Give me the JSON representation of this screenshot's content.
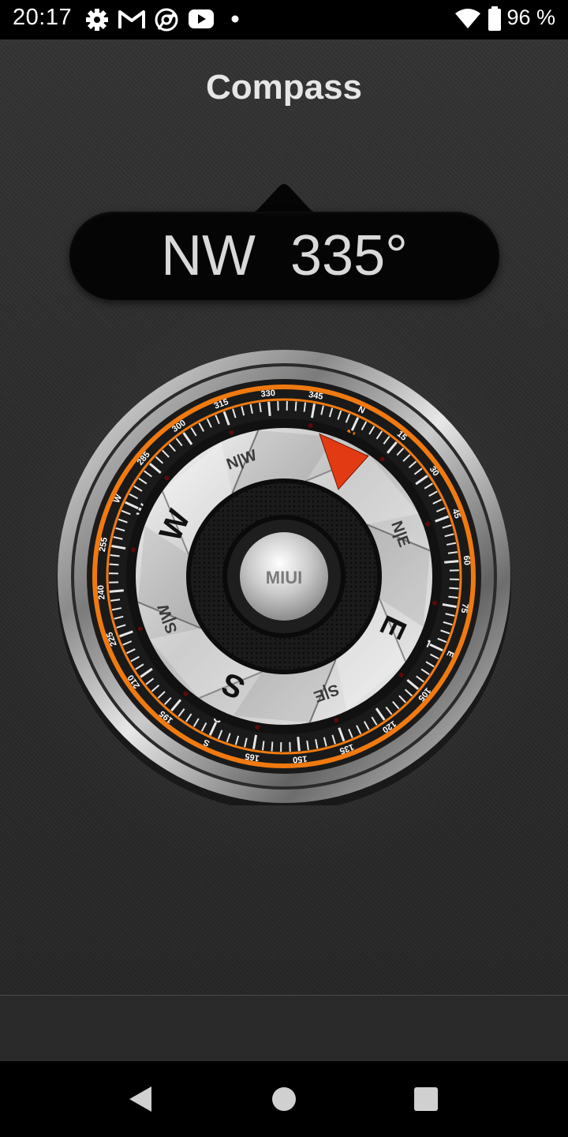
{
  "status_bar": {
    "time": "20:17",
    "battery_percent_text": "96 %",
    "icons": [
      "settings-icon",
      "gmail-icon",
      "chrome-icon",
      "youtube-icon",
      "notification-dot-icon",
      "wifi-icon",
      "battery-icon"
    ]
  },
  "app": {
    "title": "Compass",
    "heading": {
      "direction": "NW",
      "degrees": "335°"
    },
    "compass": {
      "center_label": "MIUI",
      "cardinal_labels": [
        "N",
        "E",
        "S",
        "W"
      ],
      "intercardinal_labels": [
        "N|E",
        "S|E",
        "S|W",
        "N|W"
      ],
      "ring_degree_labels": [
        "N",
        "15",
        "30",
        "45",
        "60",
        "75",
        "E",
        "105",
        "120",
        "135",
        "150",
        "165",
        "S",
        "195",
        "210",
        "225",
        "240",
        "255",
        "W",
        "285",
        "300",
        "315",
        "330",
        "345"
      ],
      "heading_value": 335,
      "accent_color": "#f07a10",
      "pointer_color": "#e23a12"
    }
  },
  "nav_bar": {
    "buttons": [
      "back-icon",
      "home-icon",
      "recents-icon"
    ]
  }
}
